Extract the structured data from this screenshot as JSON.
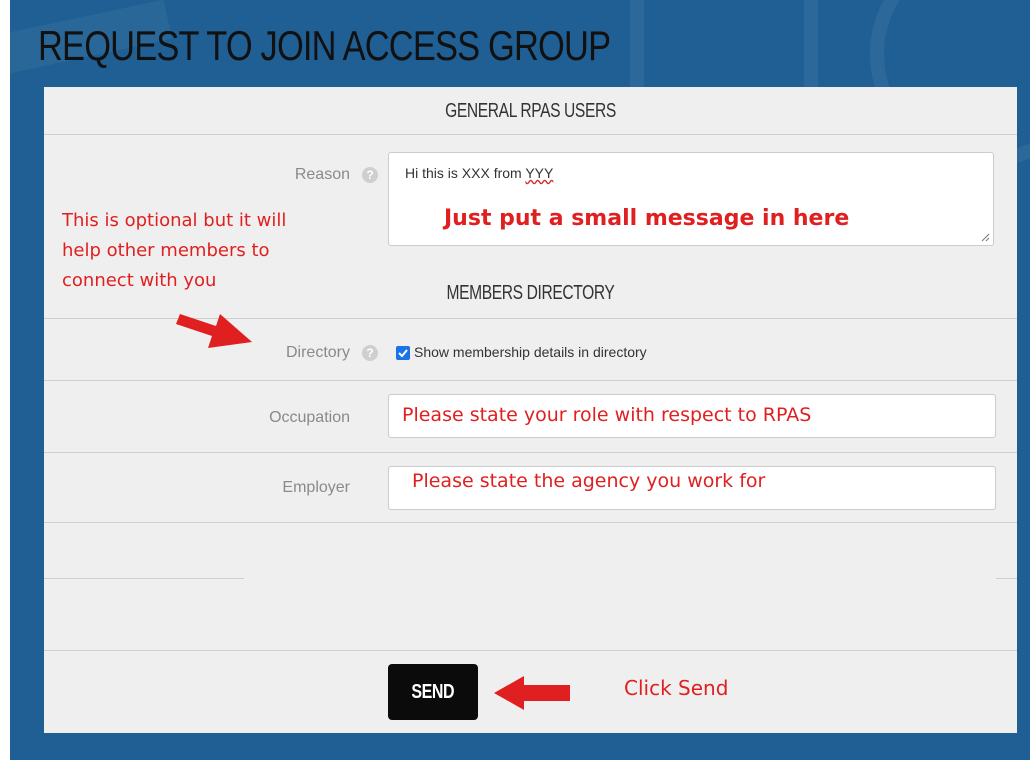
{
  "page": {
    "title": "REQUEST TO JOIN ACCESS GROUP"
  },
  "sections": {
    "general": "GENERAL RPAS USERS",
    "directory": "MEMBERS DIRECTORY"
  },
  "fields": {
    "reason": {
      "label": "Reason",
      "value_prefix": "Hi this is XXX from ",
      "value_underlined": "YYY"
    },
    "directory": {
      "label": "Directory",
      "checkbox_label": "Show membership details in directory",
      "checked": true
    },
    "occupation": {
      "label": "Occupation"
    },
    "employer": {
      "label": "Employer"
    }
  },
  "actions": {
    "send_label": "SEND"
  },
  "annotations": {
    "reason_hint": "Just put a small message in here",
    "optional_line1": "This is optional but it will",
    "optional_line2": "help other members to",
    "optional_line3": "connect with you",
    "occupation_hint": "Please state your role with respect to RPAS",
    "employer_hint": "Please state the agency you work for",
    "send_hint": "Click Send"
  },
  "icons": {
    "help": "question-circle-icon",
    "resize": "resize-handle-icon",
    "checkmark": "checkmark-icon",
    "arrow": "red-arrow-icon"
  },
  "colors": {
    "frame": "#1f5f94",
    "panel": "#efefef",
    "annotation": "#e02020",
    "button": "#0b0b0b",
    "checkbox": "#1a73e8"
  }
}
